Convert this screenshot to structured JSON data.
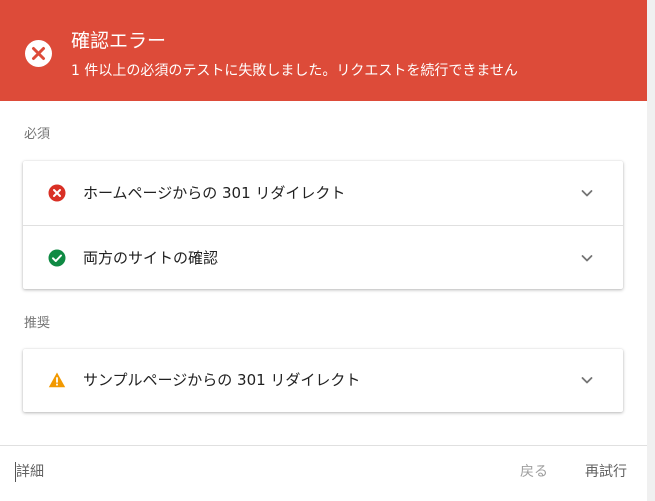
{
  "header": {
    "title": "確認エラー",
    "subtitle": "1 件以上の必須のテストに失敗しました。リクエストを続行できません",
    "background": "#dd4b39"
  },
  "sections": [
    {
      "label": "必須",
      "items": [
        {
          "label": "ホームページからの 301 リダイレクト",
          "status": "error",
          "icon": "error-icon",
          "color": "#d93025"
        },
        {
          "label": "両方のサイトの確認",
          "status": "success",
          "icon": "check-circle-icon",
          "color": "#0f8a43"
        }
      ]
    },
    {
      "label": "推奨",
      "items": [
        {
          "label": "サンプルページからの 301 リダイレクト",
          "status": "warning",
          "icon": "warning-icon",
          "color": "#f29900"
        }
      ]
    }
  ],
  "footer": {
    "details_label": "詳細",
    "back_label": "戻る",
    "retry_label": "再試行"
  }
}
